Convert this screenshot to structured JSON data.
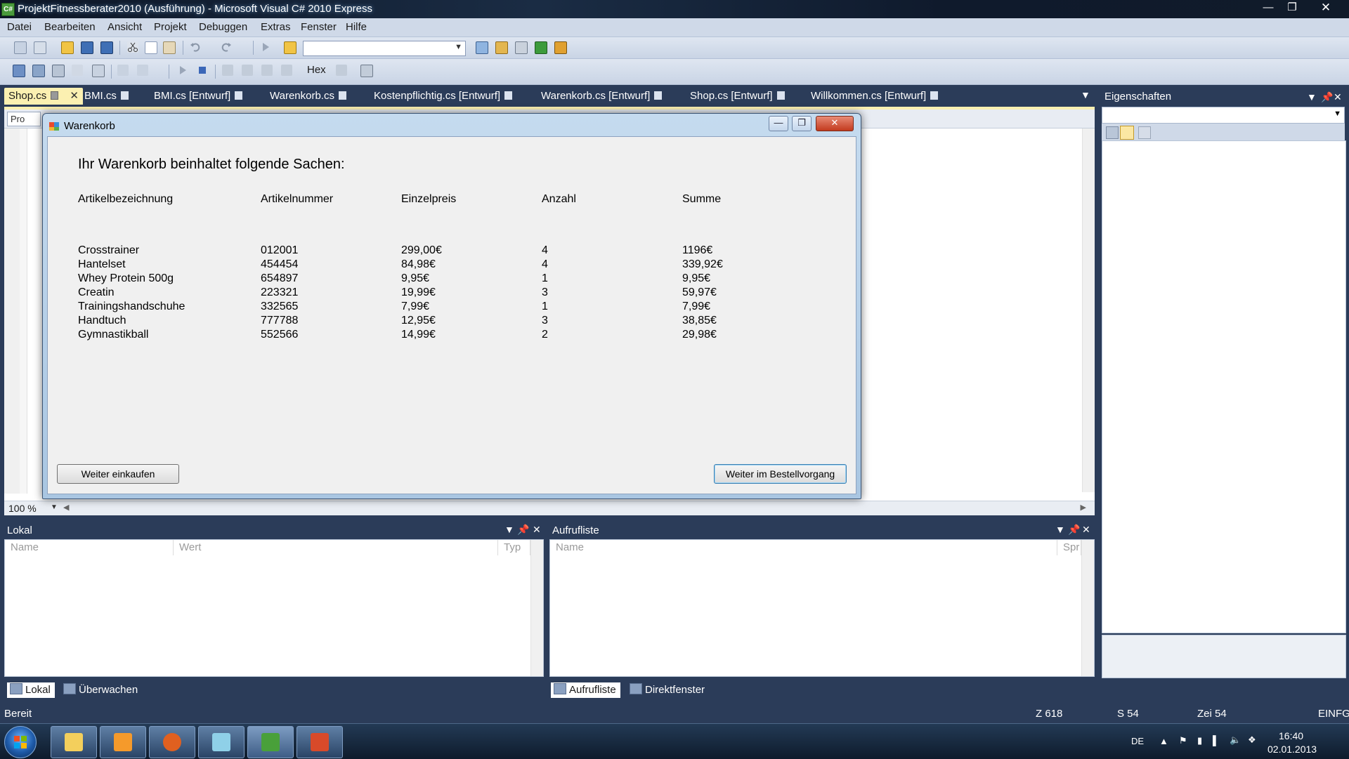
{
  "window": {
    "title": "ProjektFitnessberater2010 (Ausführung) - Microsoft Visual C# 2010 Express",
    "app_icon": "C#"
  },
  "menu": [
    "Datei",
    "Bearbeiten",
    "Ansicht",
    "Projekt",
    "Debuggen",
    "Extras",
    "Fenster",
    "Hilfe"
  ],
  "toolbar2": {
    "hex_label": "Hex"
  },
  "doc_tabs": [
    "Shop.cs",
    "BMI.cs",
    "BMI.cs [Entwurf]",
    "Warenkorb.cs",
    "Kostenpflichtig.cs [Entwurf]",
    "Warenkorb.cs [Entwurf]",
    "Shop.cs [Entwurf]",
    "Willkommen.cs [Entwurf]"
  ],
  "editor": {
    "nav_text": "Pro",
    "zoom": "100 %"
  },
  "properties": {
    "title": "Eigenschaften"
  },
  "locals": {
    "title": "Lokal",
    "columns": [
      "Name",
      "Wert",
      "Typ"
    ],
    "tabs": [
      "Lokal",
      "Überwachen"
    ]
  },
  "callstack": {
    "title": "Aufrufliste",
    "columns": [
      "Name",
      "Spr"
    ],
    "tabs": [
      "Aufrufliste",
      "Direktfenster"
    ]
  },
  "status": {
    "ready": "Bereit",
    "line": "Z 618",
    "col": "S 54",
    "char": "Zei 54",
    "mode": "EINFG"
  },
  "tray": {
    "lang": "DE",
    "time": "16:40",
    "date": "02.01.2013"
  },
  "warenkorb": {
    "caption": "Warenkorb",
    "heading": "Ihr Warenkorb beinhaltet folgende Sachen:",
    "columns": [
      "Artikelbezeichnung",
      "Artikelnummer",
      "Einzelpreis",
      "Anzahl",
      "Summe"
    ],
    "rows": [
      [
        "Crosstrainer",
        "012001",
        "299,00€",
        "4",
        "1196€"
      ],
      [
        "Hantelset",
        "454454",
        "84,98€",
        "4",
        "339,92€"
      ],
      [
        "Whey Protein 500g",
        "654897",
        "9,95€",
        "1",
        "9,95€"
      ],
      [
        "Creatin",
        "223321",
        "19,99€",
        "3",
        "59,97€"
      ],
      [
        "Trainingshandschuhe",
        "332565",
        "7,99€",
        "1",
        "7,99€"
      ],
      [
        "Handtuch",
        "777788",
        "12,95€",
        "3",
        "38,85€"
      ],
      [
        "Gymnastikball",
        "552566",
        "14,99€",
        "2",
        "29,98€"
      ]
    ],
    "btn_continue_shopping": "Weiter einkaufen",
    "btn_checkout": "Weiter im Bestellvorgang"
  }
}
